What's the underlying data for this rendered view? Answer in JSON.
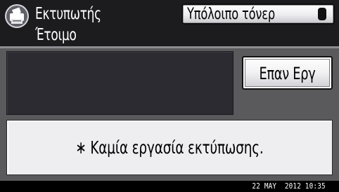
{
  "header": {
    "mode_title": "Εκτυπωτής",
    "status_text": "Έτοιμο",
    "toner_button_label": "Υπόλοιπο τόνερ",
    "printer_icon": "printer-icon",
    "toner_icon": "toner-cartridge-icon"
  },
  "main": {
    "message_text": "",
    "jobs_button_label": "Επαν Εργ"
  },
  "job_list": {
    "empty_message": "∗ Καμία εργασία εκτύπωσης."
  },
  "footer": {
    "datetime": "22 MAY  2012 10:35"
  },
  "colors": {
    "background": "#5a5a5c",
    "header": "#1c1c1e",
    "message_box": "#2b2b31",
    "panel": "#eeeef0",
    "text_light": "#ffffff"
  }
}
